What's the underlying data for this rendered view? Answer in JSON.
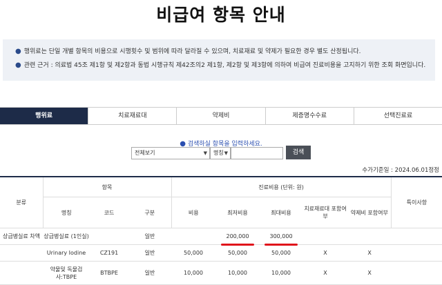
{
  "page_title": "비급여 항목 안내",
  "notice": {
    "lines": [
      "행위료는 단일 개별 항목의 비용으로 시행횟수 및 범위에 따라 달라질 수 있으며, 치료재료 및 약제가 필요한 경우 별도 산정됩니다.",
      "관련 근거 : 의료법 45조 제1항 및 제2항과 동법 시행규칙 제42조의2 제1항, 제2항 및 제3항에 의하여 비급여 진료비용을 고지하기 위한 조회 화면입니다."
    ]
  },
  "tabs": [
    "행위료",
    "치료재료대",
    "약제비",
    "제증명수수료",
    "선택진료료"
  ],
  "active_tab": "행위료",
  "search": {
    "hint": "검색하실 항목을 입력하세요.",
    "category_value": "전체보기",
    "field_value": "명칭",
    "input_value": "",
    "button_label": "검색"
  },
  "apply_date": "수가기준일 : 2024.06.01정정",
  "table": {
    "header_top": {
      "category": "분류",
      "item": "항목",
      "cost_group": "진료비용 (단위: 원)",
      "note": "특이사항"
    },
    "header_sub": {
      "name": "명칭",
      "code": "코드",
      "type": "구분",
      "cost": "비용",
      "min_cost": "최저비용",
      "max_cost": "최대비용",
      "material": "치료재료대 포함여부",
      "drug": "약제비 포함여부"
    },
    "rows": [
      {
        "category": "상급병실료 차액",
        "name": "상급병실료 (1인실)",
        "code": "",
        "type": "일반",
        "cost": "",
        "min_cost": "200,000",
        "max_cost": "300,000",
        "material": "",
        "drug": "",
        "note": ""
      },
      {
        "category": "",
        "name": "Urinary Iodine",
        "code": "CZ191",
        "type": "일반",
        "cost": "50,000",
        "min_cost": "50,000",
        "max_cost": "50,000",
        "material": "X",
        "drug": "X",
        "note": ""
      },
      {
        "category": "",
        "name": "약물및 독물검사:TBPE",
        "code": "BTBPE",
        "type": "일반",
        "cost": "10,000",
        "min_cost": "10,000",
        "max_cost": "10,000",
        "material": "X",
        "drug": "X",
        "note": ""
      }
    ]
  }
}
